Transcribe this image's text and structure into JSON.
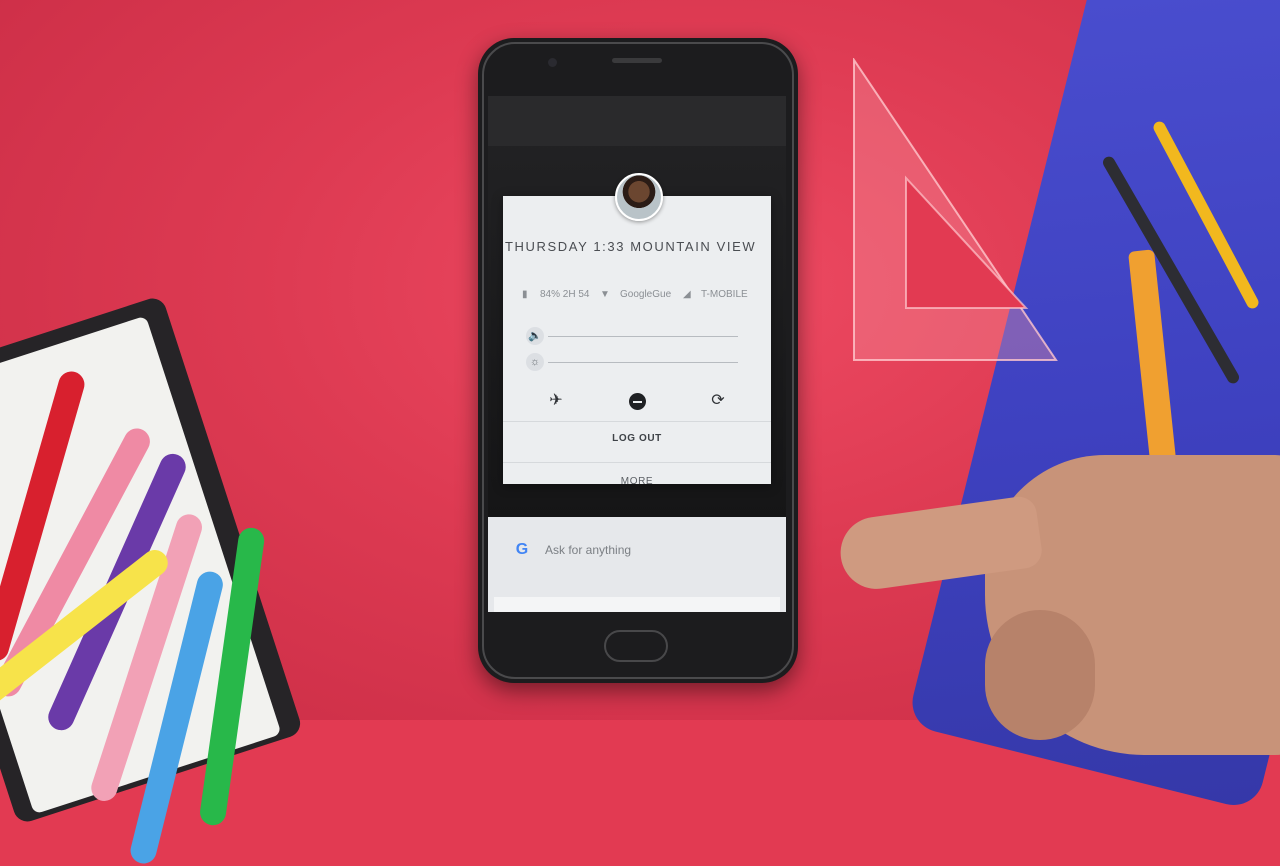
{
  "lockscreen": {
    "datetime": "THURSDAY 1:33 MOUNTAIN VIEW",
    "battery": "84% 2H 54",
    "wifi": "GoogleGue",
    "carrier": "T-MOBILE",
    "logout_label": "LOG OUT",
    "more_label": "MORE"
  },
  "search": {
    "placeholder": "Ask for anything",
    "logo": "G"
  },
  "icons": {
    "volume": "volume-icon",
    "brightness": "brightness-icon",
    "airplane": "airplane-icon",
    "dnd": "do-not-disturb-icon",
    "rotate": "auto-rotate-icon"
  },
  "colors": {
    "background": "#e23a52",
    "dialog": "#eceef0",
    "google_blue": "#4285f4"
  }
}
